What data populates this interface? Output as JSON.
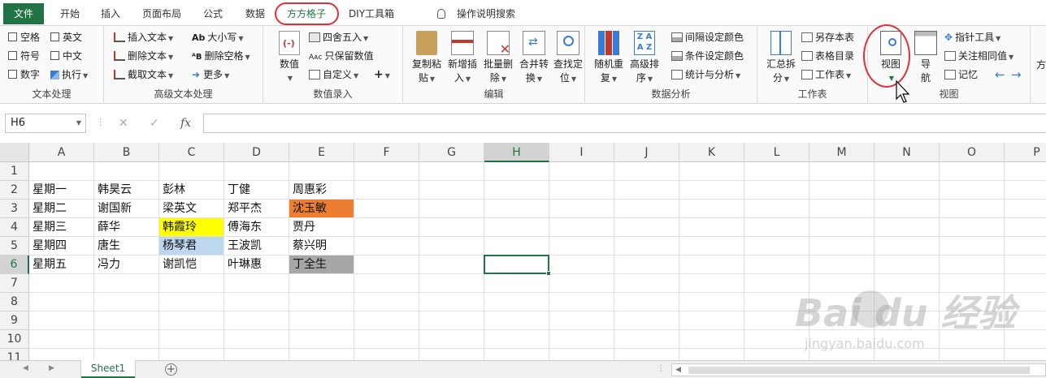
{
  "ribbon_tabs": [
    {
      "label": "文件"
    },
    {
      "label": "开始"
    },
    {
      "label": "插入"
    },
    {
      "label": "页面布局"
    },
    {
      "label": "公式"
    },
    {
      "label": "数据"
    },
    {
      "label": "方方格子"
    },
    {
      "label": "DIY工具箱"
    }
  ],
  "tell_me": "操作说明搜索",
  "groups": {
    "text": {
      "title": "文本处理",
      "items": [
        "空格",
        "英文",
        "符号",
        "中文",
        "数字",
        "执行"
      ]
    },
    "adv_text": {
      "title": "高级文本处理",
      "items": [
        "插入文本",
        "删除文本",
        "截取文本",
        "大小写",
        "删除空格",
        "更多"
      ]
    },
    "num_entry": {
      "title": "数值录入",
      "big": "数值",
      "items": [
        "四舍五入",
        "只保留数值",
        "自定义"
      ]
    },
    "edit": {
      "title": "编辑",
      "buttons": [
        {
          "line1": "复制粘",
          "line2": "贴"
        },
        {
          "line1": "新增插",
          "line2": "入"
        },
        {
          "line1": "批量删",
          "line2": "除"
        },
        {
          "line1": "合并转",
          "line2": "换"
        },
        {
          "line1": "查找定",
          "line2": "位"
        }
      ]
    },
    "analysis": {
      "title": "数据分析",
      "buttons": [
        {
          "line1": "随机重",
          "line2": "复"
        },
        {
          "line1": "高级排",
          "line2": "序"
        }
      ],
      "items": [
        "间隔设定颜色",
        "条件设定颜色",
        "统计与分析"
      ]
    },
    "worksheet": {
      "title": "工作表",
      "big": {
        "line1": "汇总拆",
        "line2": "分"
      },
      "items": [
        "另存本表",
        "表格目录",
        "工作表"
      ]
    },
    "view": {
      "title": "视图",
      "buttons": [
        {
          "line1": "视图"
        },
        {
          "line1": "导",
          "line2": "航"
        }
      ],
      "items": [
        "指针工具",
        "关注相同值",
        "记忆"
      ]
    },
    "partial": {
      "line1": "方"
    }
  },
  "name_box": "H6",
  "fx_label": "fx",
  "columns": [
    "A",
    "B",
    "C",
    "D",
    "E",
    "F",
    "G",
    "H",
    "I",
    "J",
    "K",
    "L",
    "M",
    "N",
    "O",
    "P"
  ],
  "selected_column": "H",
  "selected_row": "6",
  "rows": [
    {
      "num": "1",
      "cells": [
        "",
        "",
        "",
        "",
        ""
      ]
    },
    {
      "num": "2",
      "cells": [
        "星期一",
        "韩昊云",
        "彭林",
        "丁健",
        "周惠彩"
      ]
    },
    {
      "num": "3",
      "cells": [
        "星期二",
        "谢国新",
        "梁英文",
        "郑平杰",
        "沈玉敏"
      ]
    },
    {
      "num": "4",
      "cells": [
        "星期三",
        "薛华",
        "韩霞玲",
        "傅海东",
        "贾丹"
      ]
    },
    {
      "num": "5",
      "cells": [
        "星期四",
        "唐生",
        "杨琴君",
        "王波凯",
        "蔡兴明"
      ]
    },
    {
      "num": "6",
      "cells": [
        "星期五",
        "冯力",
        "谢凯恺",
        "叶琳惠",
        "丁全生"
      ]
    },
    {
      "num": "7",
      "cells": []
    },
    {
      "num": "8",
      "cells": []
    },
    {
      "num": "9",
      "cells": []
    },
    {
      "num": "10",
      "cells": []
    },
    {
      "num": "11",
      "cells": []
    }
  ],
  "cell_fills": {
    "E3": "#ed7d31",
    "C4": "#ffff00",
    "C5": "#bdd7ee",
    "E6": "#a6a6a6"
  },
  "sheet_tab": "Sheet1",
  "colors": {
    "accent": "#217346",
    "annotation": "#e0303a"
  },
  "watermark": {
    "main": "Bai du 经验",
    "sub": "jingyan.baidu.com"
  }
}
